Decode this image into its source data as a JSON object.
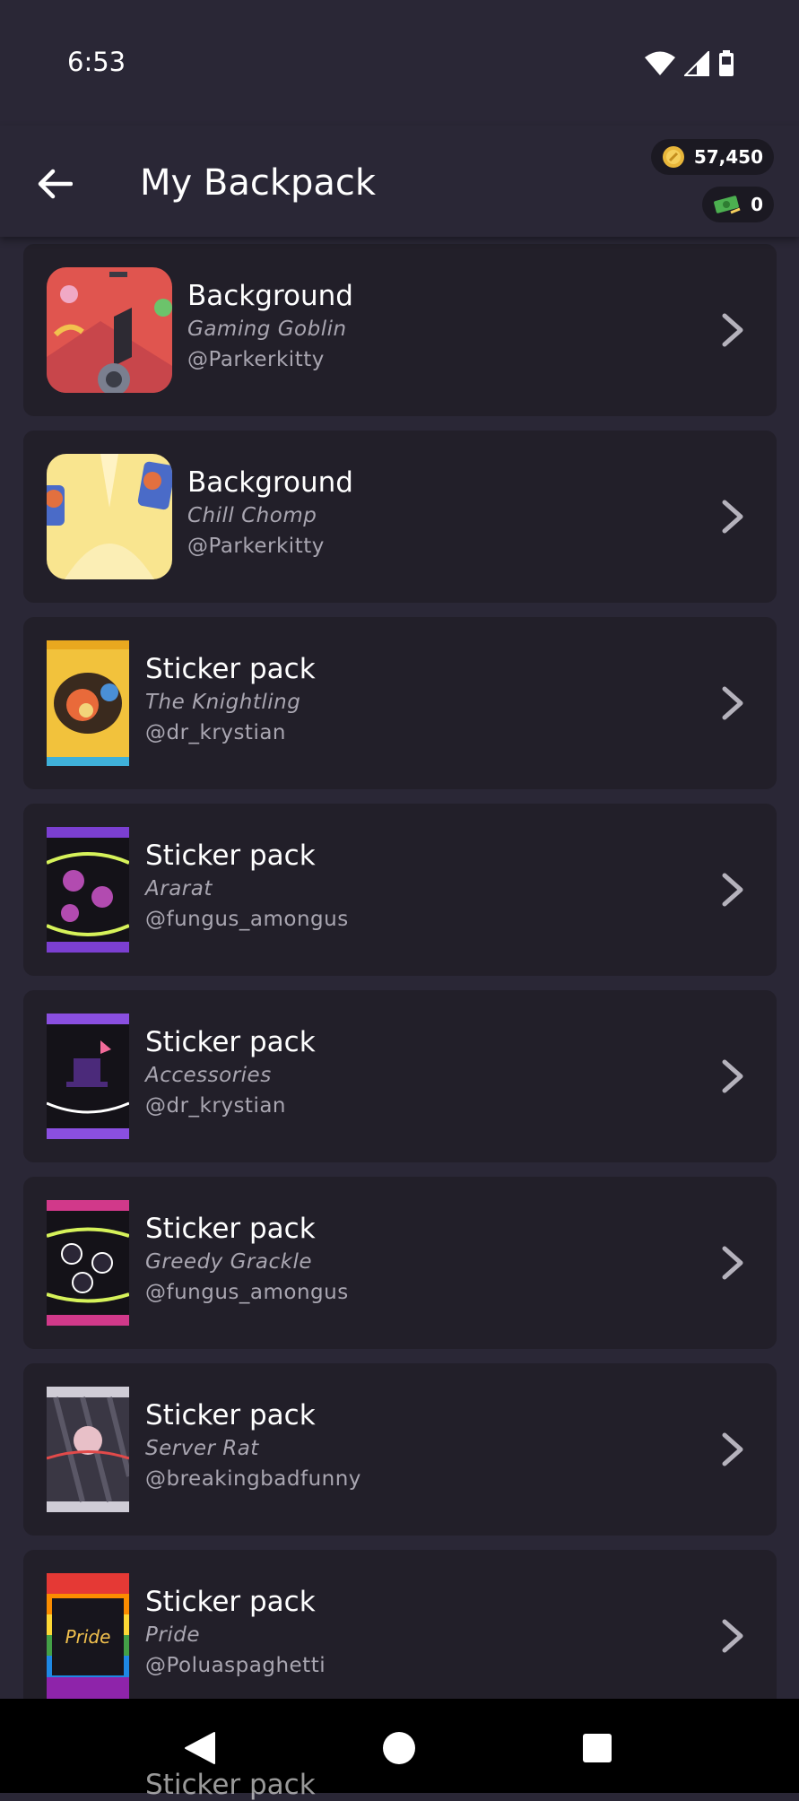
{
  "status_bar": {
    "time": "6:53"
  },
  "header": {
    "title": "My Backpack",
    "coins": "57,450",
    "cash": "0"
  },
  "items": [
    {
      "type": "Background",
      "name": "Gaming Goblin",
      "author": "@Parkerkitty",
      "thumb": "background-gaming-goblin"
    },
    {
      "type": "Background",
      "name": "Chill Chomp",
      "author": "@Parkerkitty",
      "thumb": "background-chill-chomp"
    },
    {
      "type": "Sticker pack",
      "name": "The Knightling",
      "author": "@dr_krystian",
      "thumb": "sticker-pack-yellow"
    },
    {
      "type": "Sticker pack",
      "name": "Ararat",
      "author": "@fungus_amongus",
      "thumb": "sticker-pack-purple"
    },
    {
      "type": "Sticker pack",
      "name": "Accessories",
      "author": "@dr_krystian",
      "thumb": "sticker-pack-purple-hat"
    },
    {
      "type": "Sticker pack",
      "name": "Greedy Grackle",
      "author": "@fungus_amongus",
      "thumb": "sticker-pack-pink"
    },
    {
      "type": "Sticker pack",
      "name": "Server Rat",
      "author": "@breakingbadfunny",
      "thumb": "sticker-pack-gray"
    },
    {
      "type": "Sticker pack",
      "name": "Pride",
      "author": "@Poluaspaghetti",
      "thumb": "sticker-pack-rainbow"
    }
  ],
  "peek_item": {
    "type": "Sticker pack"
  },
  "colors": {
    "background": "#2a2736",
    "card": "#221f29",
    "subtext": "#a9a6b1",
    "coin": "#e8b63a",
    "cash": "#4caf50"
  },
  "icons": {
    "back": "arrow-left-icon",
    "chevron": "chevron-right-icon",
    "coin": "coin-icon",
    "cash": "cash-icon",
    "wifi": "wifi-icon",
    "signal": "signal-icon",
    "battery": "battery-icon",
    "nav_back": "nav-back-icon",
    "nav_home": "nav-home-icon",
    "nav_recents": "nav-recents-icon"
  }
}
